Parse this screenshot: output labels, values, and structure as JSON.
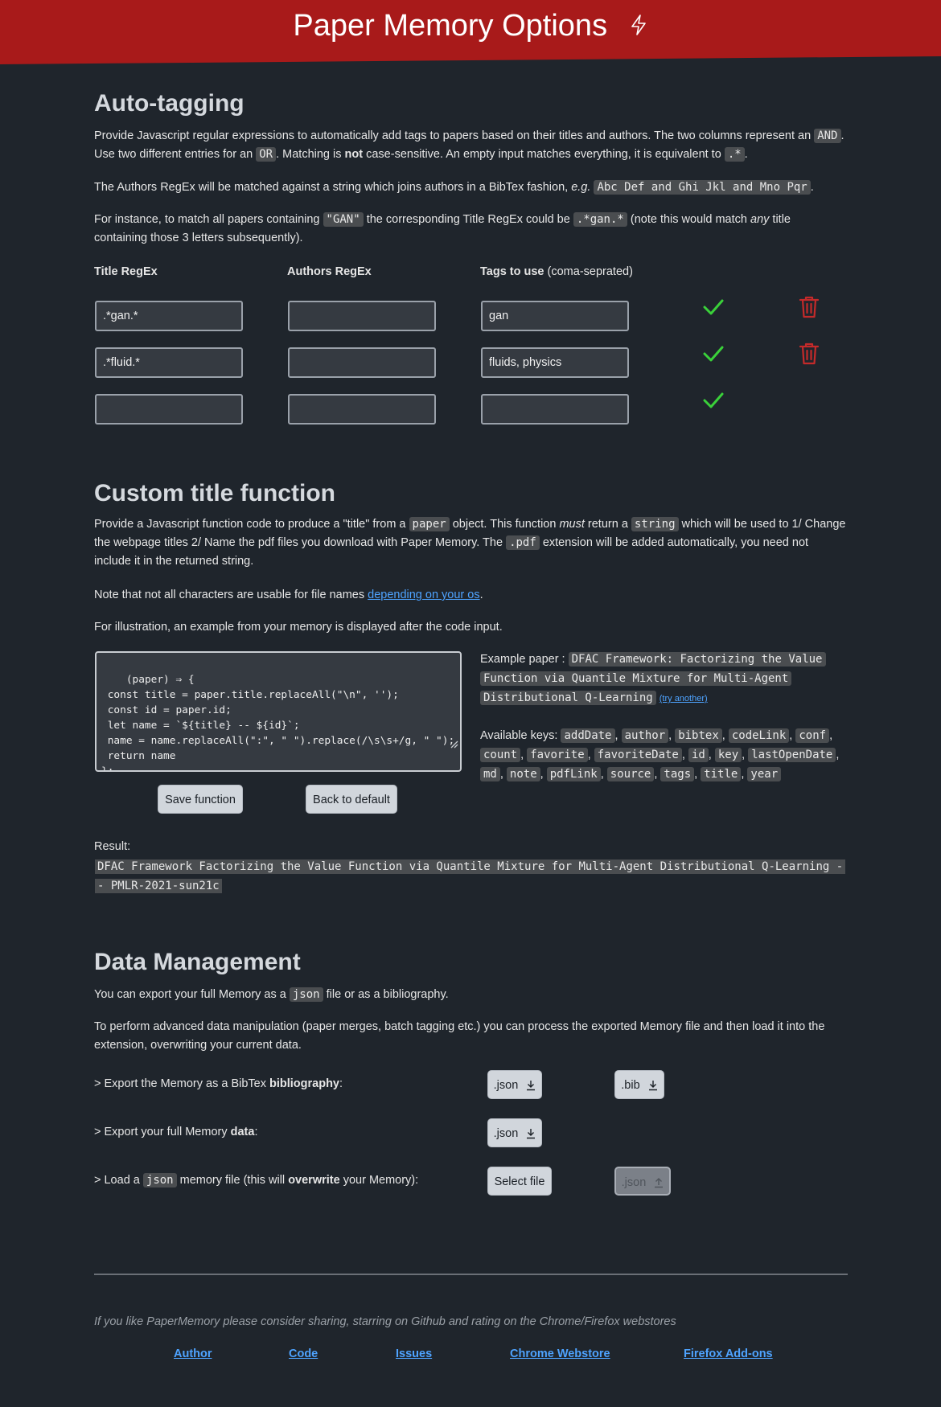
{
  "header": {
    "title": "Paper Memory Options"
  },
  "autotag": {
    "heading": "Auto-tagging",
    "p1_a": "Provide Javascript regular expressions to automatically add tags to papers based on their titles and authors. The two columns represent an",
    "p1_and": "AND",
    "p1_b": ". Use two different entries for an",
    "p1_or": "OR",
    "p1_c": ". Matching is",
    "p1_not": "not",
    "p1_d": "case-sensitive. An empty input matches everything, it is equivalent to",
    "p1_dotstar": ".*",
    "p1_e": ".",
    "p2_a": "The Authors RegEx will be matched against a string which joins authors in a BibTex fashion,",
    "p2_eg": "e.g.",
    "p2_code": "Abc Def and Ghi Jkl and Mno Pqr",
    "p2_b": ".",
    "p3_a": "For instance, to match all papers containing",
    "p3_gan": "\"GAN\"",
    "p3_b": "the corresponding Title RegEx could be",
    "p3_code": ".*gan.*",
    "p3_c": "(note this would match",
    "p3_any": "any",
    "p3_d": "title containing those 3 letters subsequently).",
    "col_title": "Title RegEx",
    "col_authors": "Authors RegEx",
    "col_tags_bold": "Tags to use",
    "col_tags_rest": " (coma-seprated)",
    "rows": [
      {
        "title": ".*gan.*",
        "authors": "",
        "tags": "gan"
      },
      {
        "title": ".*fluid.*",
        "authors": "",
        "tags": "fluids, physics"
      },
      {
        "title": "",
        "authors": "",
        "tags": ""
      }
    ]
  },
  "custom": {
    "heading": "Custom title function",
    "p1_a": "Provide a Javascript function code to produce a \"title\" from a",
    "p1_paper": "paper",
    "p1_b": "object. This function",
    "p1_must": "must",
    "p1_c": "return a",
    "p1_string": "string",
    "p1_d": "which will be used to 1/ Change the webpage titles 2/ Name the pdf files you download with Paper Memory. The",
    "p1_pdf": ".pdf",
    "p1_e": "extension will be added automatically, you need not include it in the returned string.",
    "p2_a": "Note that not all characters are usable for file names",
    "p2_link": "depending on your os",
    "p2_b": ".",
    "p3": "For illustration, an example from your memory is displayed after the code input.",
    "code": "(paper) ⇒ {\n const title = paper.title.replaceAll(\"\\n\", '');\n const id = paper.id;\n let name = `${title} -- ${id}`;\n name = name.replaceAll(\":\", \" \").replace(/\\s\\s+/g, \" \");\n return name\n};",
    "save_label": "Save function",
    "default_label": "Back to default",
    "example_label": "Example paper :",
    "example_title_1": "DFAC Framework: Factorizing the Value",
    "example_title_2": "Function via Quantile Mixture for Multi-Agent",
    "example_title_3": "Distributional Q-Learning",
    "try_another": "(try another)",
    "keys_label": "Available keys:",
    "keys": [
      "addDate",
      "author",
      "bibtex",
      "codeLink",
      "conf",
      "count",
      "favorite",
      "favoriteDate",
      "id",
      "key",
      "lastOpenDate",
      "md",
      "note",
      "pdfLink",
      "source",
      "tags",
      "title",
      "year"
    ],
    "result_label": "Result:",
    "result_1": "DFAC Framework Factorizing the Value Function via Quantile Mixture for Multi-Agent Distributional Q-Learning -",
    "result_2": "- PMLR-2021-sun21c"
  },
  "data_mgmt": {
    "heading": "Data Management",
    "p1_a": "You can export your full Memory as a",
    "p1_json": "json",
    "p1_b": "file or as a bibliography.",
    "p2": "To perform advanced data manipulation (paper merges, batch tagging etc.) you can process the exported Memory file and then load it into the extension, overwriting your current data.",
    "row1_a": "> Export the Memory as a BibTex",
    "row1_bold": "bibliography",
    "row1_b": ":",
    "row2_a": "> Export your full Memory",
    "row2_bold": "data",
    "row2_b": ":",
    "row3_a": "> Load a",
    "row3_json": "json",
    "row3_b": "memory file (this will",
    "row3_bold": "overwrite",
    "row3_c": "your Memory):",
    "btn_json": ".json",
    "btn_bib": ".bib",
    "btn_select": "Select file",
    "btn_json_upload": ".json"
  },
  "footer": {
    "note": "If you like PaperMemory please consider sharing, starring on Github and rating on the Chrome/Firefox webstores",
    "links": [
      "Author",
      "Code",
      "Issues",
      "Chrome Webstore",
      "Firefox Add-ons"
    ]
  },
  "colors": {
    "header": "#a81a1a",
    "background": "#1f252c",
    "check": "#3ad13a",
    "trash": "#c42a2a",
    "link": "#4ea3ff"
  }
}
